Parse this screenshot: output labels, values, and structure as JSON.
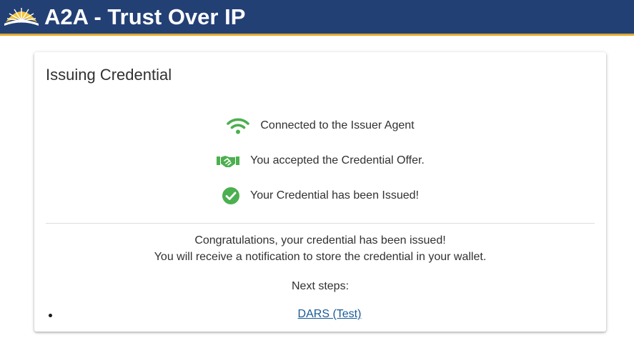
{
  "header": {
    "title": "A2A - Trust Over IP",
    "logo_icon": "sun-rays-logo",
    "background_color": "#234075",
    "accent_color": "#e3a82b"
  },
  "card": {
    "title": "Issuing Credential",
    "steps": [
      {
        "icon": "wifi-icon",
        "text": "Connected to the Issuer Agent"
      },
      {
        "icon": "handshake-icon",
        "text": "You accepted the Credential Offer."
      },
      {
        "icon": "check-circle-icon",
        "text": "Your Credential has been Issued!"
      }
    ],
    "success_color": "#4caf50",
    "message_line1": "Congratulations, your credential has been issued!",
    "message_line2": "You will receive a notification to store the credential in your wallet.",
    "next_steps_label": "Next steps:",
    "next_steps": [
      {
        "label": "DARS (Test)"
      }
    ]
  }
}
